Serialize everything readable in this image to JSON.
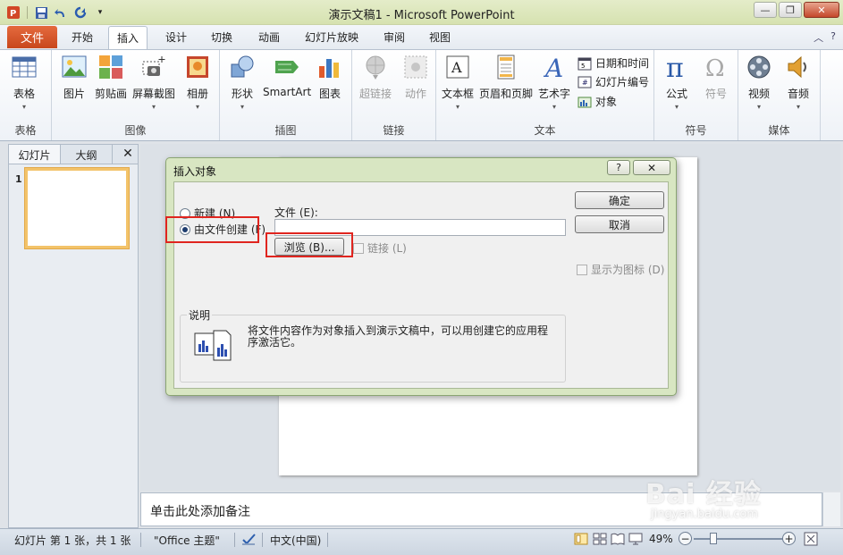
{
  "window": {
    "title": "演示文稿1 - Microsoft PowerPoint"
  },
  "tabs": {
    "file": "文件",
    "items": [
      "开始",
      "插入",
      "设计",
      "切换",
      "动画",
      "幻灯片放映",
      "审阅",
      "视图"
    ],
    "active": "插入"
  },
  "ribbon": {
    "groups": {
      "tables": "表格",
      "images": "图像",
      "illustrations": "插图",
      "links": "链接",
      "text": "文本",
      "symbols": "符号",
      "media": "媒体"
    },
    "buttons": {
      "table": "表格",
      "picture": "图片",
      "clipart": "剪贴画",
      "screenshot": "屏幕截图",
      "album": "相册",
      "shapes": "形状",
      "smartart": "SmartArt",
      "chart": "图表",
      "hyperlink": "超链接",
      "action": "动作",
      "textbox": "文本框",
      "header_footer": "页眉和页脚",
      "wordart": "艺术字",
      "datetime": "日期和时间",
      "slide_number": "幻灯片编号",
      "object": "对象",
      "equation": "公式",
      "symbol": "符号",
      "video": "视频",
      "audio": "音频"
    }
  },
  "left_pane": {
    "tab_slides": "幻灯片",
    "tab_outline": "大纲",
    "close": "✕",
    "slide_number": "1"
  },
  "notes": {
    "placeholder": "单击此处添加备注"
  },
  "status": {
    "slide_info": "幻灯片 第 1 张，共 1 张",
    "theme": "\"Office 主题\"",
    "language": "中文(中国)",
    "zoom": "49%"
  },
  "dialog": {
    "title": "插入对象",
    "help": "?",
    "close": "✕",
    "radio_new": "新建 (N)",
    "radio_from_file": "由文件创建 (F)",
    "file_label": "文件 (E):",
    "file_value": "",
    "browse": "浏览 (B)...",
    "link": "链接 (L)",
    "ok": "确定",
    "cancel": "取消",
    "display_as_icon": "显示为图标 (D)",
    "description_label": "说明",
    "description_text": "将文件内容作为对象插入到演示文稿中，可以用创建它的应用程序激活它。"
  },
  "watermark": {
    "text": "Bai 经验",
    "sub": "jingyan.baidu.com"
  },
  "colors": {
    "accent": "#c8471c",
    "highlight": "#e0251f",
    "dialog_frame": "#d8e6c2"
  }
}
